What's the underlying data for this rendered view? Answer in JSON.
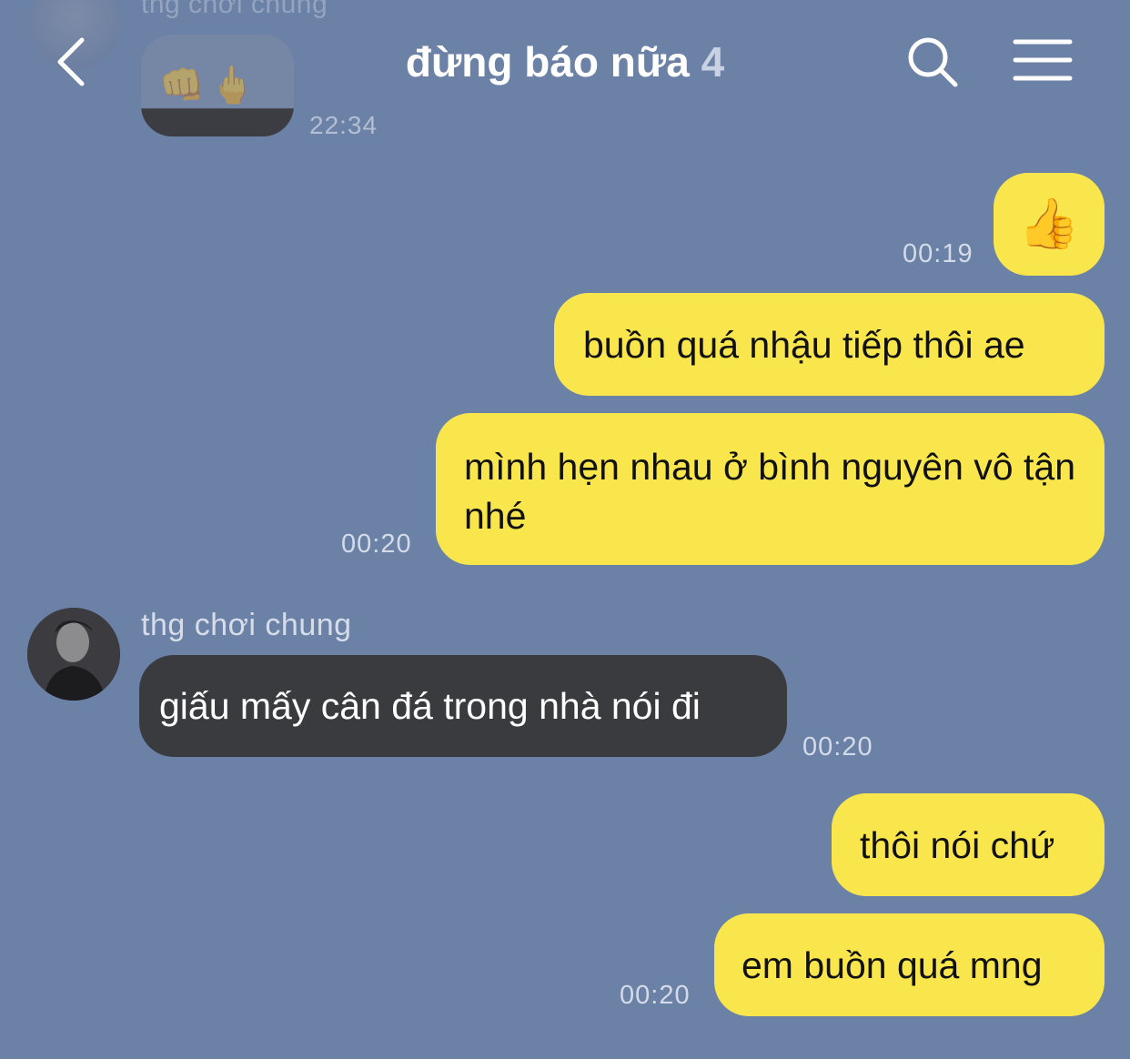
{
  "header": {
    "title": "đừng báo nữa",
    "member_count": "4"
  },
  "previous_message": {
    "sender": "thg chơi chung",
    "emoji": "👊🖕",
    "time": "22:34"
  },
  "messages": [
    {
      "side": "me",
      "type": "emoji",
      "text": "👍",
      "time": "00:19"
    },
    {
      "side": "me",
      "type": "text",
      "text": "buồn quá nhậu tiếp thôi ae",
      "time": ""
    },
    {
      "side": "me",
      "type": "text",
      "text": "mình hẹn nhau ở bình nguyên vô tận nhé",
      "time": "00:20"
    },
    {
      "side": "other",
      "sender": "thg chơi chung",
      "type": "text",
      "text": "giấu mấy cân đá trong nhà nói đi",
      "time": "00:20"
    },
    {
      "side": "me",
      "type": "text",
      "text": "thôi nói chứ",
      "time": ""
    },
    {
      "side": "me",
      "type": "text",
      "text": "em buồn quá mng",
      "time": "00:20"
    }
  ],
  "colors": {
    "background": "#6c81a6",
    "my_bubble": "#f9e64c",
    "other_bubble": "#3a3b3f"
  },
  "icons": {
    "back": "chevron-left-icon",
    "search": "search-icon",
    "menu": "hamburger-menu-icon"
  }
}
